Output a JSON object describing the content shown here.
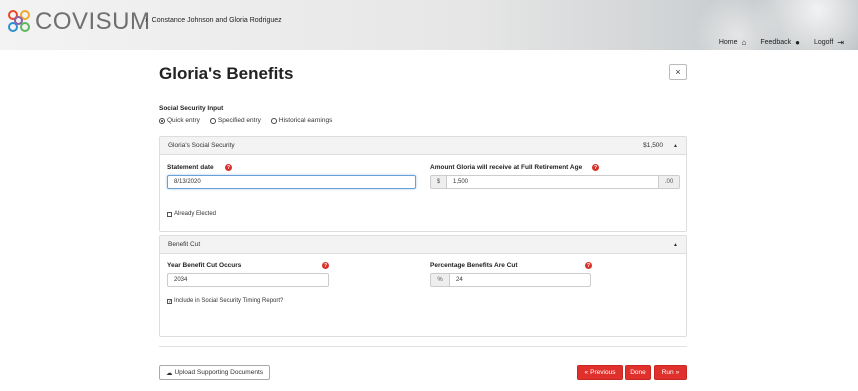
{
  "app": {
    "logo_text": "COVISUM",
    "breadcrumb": "Constance Johnson and Gloria Rodriguez"
  },
  "nav": {
    "home": "Home",
    "feedback": "Feedback",
    "logoff": "Logoff"
  },
  "page": {
    "title": "Gloria's Benefits",
    "close_icon": "×"
  },
  "ss_input": {
    "label": "Social Security Input",
    "options": [
      "Quick entry",
      "Specified entry",
      "Historical earnings"
    ],
    "selected": "Quick entry"
  },
  "ss_panel": {
    "title": "Gloria's Social Security",
    "amount": "$1,500",
    "statement_date_label": "Statement date",
    "statement_date_value": "8/13/2020",
    "fra_label": "Amount Gloria will receive at Full Retirement Age",
    "currency": "$",
    "fra_value": "1,500",
    "cents": ".00",
    "already_elected": "Already Elected"
  },
  "cut_panel": {
    "title": "Benefit Cut",
    "year_label": "Year Benefit Cut Occurs",
    "year_value": "2034",
    "pct_label": "Percentage Benefits Are Cut",
    "pct_symbol": "%",
    "pct_value": "24",
    "include_label": "Include in Social Security Timing Report?"
  },
  "footer": {
    "upload": "Upload Supporting Documents",
    "previous": "Previous",
    "done": "Done",
    "run": "Run"
  },
  "colors": {
    "accent_red": "#e0302c",
    "logo_text": "#6d6f71"
  }
}
